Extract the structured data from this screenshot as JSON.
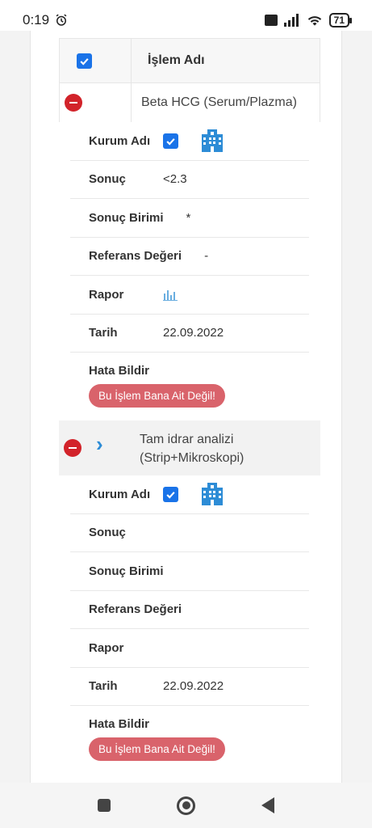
{
  "statusbar": {
    "time": "0:19",
    "battery": "71"
  },
  "header": {
    "column_title": "İşlem Adı"
  },
  "tests": [
    {
      "name": "Beta HCG (Serum/Plazma)",
      "labels": {
        "institution": "Kurum Adı",
        "result": "Sonuç",
        "unit": "Sonuç Birimi",
        "reference": "Referans Değeri",
        "report": "Rapor",
        "date": "Tarih",
        "report_error": "Hata Bildir"
      },
      "result": "<2.3",
      "unit": "*",
      "reference": "-",
      "date": "22.09.2022",
      "error_button": "Bu İşlem Bana Ait Değil!"
    },
    {
      "name_line1": "Tam idrar analizi",
      "name_line2": "(Strip+Mikroskopi)",
      "labels": {
        "institution": "Kurum Adı",
        "result": "Sonuç",
        "unit": "Sonuç Birimi",
        "reference": "Referans Değeri",
        "report": "Rapor",
        "date": "Tarih",
        "report_error": "Hata Bildir"
      },
      "result": "",
      "unit": "",
      "reference": "",
      "date": "22.09.2022",
      "error_button": "Bu İşlem Bana Ait Değil!"
    }
  ],
  "colors": {
    "accent": "#1a73e8",
    "danger": "#d2232a",
    "error_button": "#d9636b",
    "icon": "#2d8cd6"
  },
  "icons": [
    "alarm-clock-icon",
    "signal-icon",
    "wifi-icon",
    "battery-icon",
    "checkbox-checked-icon",
    "remove-circle-icon",
    "hospital-building-icon",
    "bar-chart-icon",
    "chevron-right-icon"
  ]
}
